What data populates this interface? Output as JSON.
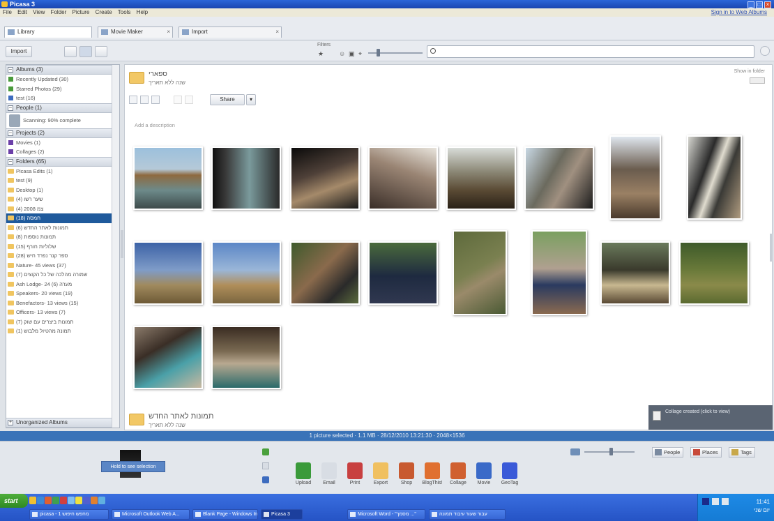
{
  "window": {
    "title": "Picasa 3",
    "sign_in": "Sign in to Web Albums"
  },
  "menu": [
    "File",
    "Edit",
    "View",
    "Folder",
    "Picture",
    "Create",
    "Tools",
    "Help"
  ],
  "tabs": [
    {
      "label": "Library",
      "active": true
    },
    {
      "label": "Movie Maker",
      "active": false
    },
    {
      "label": "Import",
      "active": false
    }
  ],
  "toolbar": {
    "import_label": "Import",
    "filters_label": "Filters"
  },
  "search": {
    "placeholder": ""
  },
  "left_panel": {
    "albums_header": "Albums (3)",
    "albums": [
      "Recently Updated (30)",
      "Starred Photos (29)",
      "test (16)"
    ],
    "people_header": "People (1)",
    "people_item": "Scanning: 90% complete",
    "projects_header": "Projects (2)",
    "projects": [
      "Movies (1)",
      "Collages (2)"
    ],
    "folders_header": "Folders (65)",
    "folders": [
      "Picasa Edits (1)",
      "test (9)",
      "Desktop (1)",
      "שער רשו (4)",
      "צמ 2008 (4)",
      "חמסה (18)",
      "תמונות לאתר החדש (6)",
      "תמונות נוספות (8)",
      "שלוליות חורף (15)",
      "ספר קנר נפרד חיש (28)",
      "Nature- 45 views (37)",
      "שמורה מהלכה של כל הקוצים (7)",
      "Ash Lodge- 24 מערה (6)",
      "Speakers- 20 views (19)",
      "Benefactors- 13 views (15)",
      "Officers- 13 views (7)",
      "תמונות ביצרים עם שוק (7)",
      "תמונה מהטיול מלבוש (1)"
    ],
    "unorganized_header": "Unorganized Albums"
  },
  "main": {
    "folder_title": "ספארי",
    "folder_subtitle": "שנה ללא תאריך",
    "share_label": "Share",
    "date_label": "Add a description",
    "view_label": "Show in folder",
    "second_folder_title": "תמונות לאתר החדש",
    "second_folder_subtitle": "שנה ללא תאריך"
  },
  "status_text": "1 picture selected · 1.1 MB · 28/12/2010 13:21:30 · 2048×1536",
  "popup_text": "Collage created (click to view)",
  "tray": {
    "hold_label": "Hold to see selection",
    "items": [
      "Upload",
      "Email",
      "Print",
      "Export",
      "Shop",
      "BlogThis!",
      "Collage",
      "Movie",
      "GeoTag"
    ]
  },
  "right_buttons": {
    "people": "People",
    "places": "Places",
    "tags": "Tags"
  },
  "taskbar": {
    "start": "start",
    "tasks": [
      {
        "label": "picasa - 1 מחפש חיפוש",
        "active": false
      },
      {
        "label": "Microsoft Outlook Web A...",
        "active": false
      },
      {
        "label": "Blank Page - Windows In...",
        "active": false
      },
      {
        "label": "Picasa 3",
        "active": true
      },
      {
        "label": "Microsoft Word - \"מסמך ...\"",
        "active": false
      },
      {
        "label": "עבור שעור עיבוד תמונה",
        "active": false
      }
    ],
    "clock": "11:41",
    "day": "יום שני"
  },
  "colors": {
    "accent": "#1f5a9c",
    "status": "#3a73b8"
  }
}
